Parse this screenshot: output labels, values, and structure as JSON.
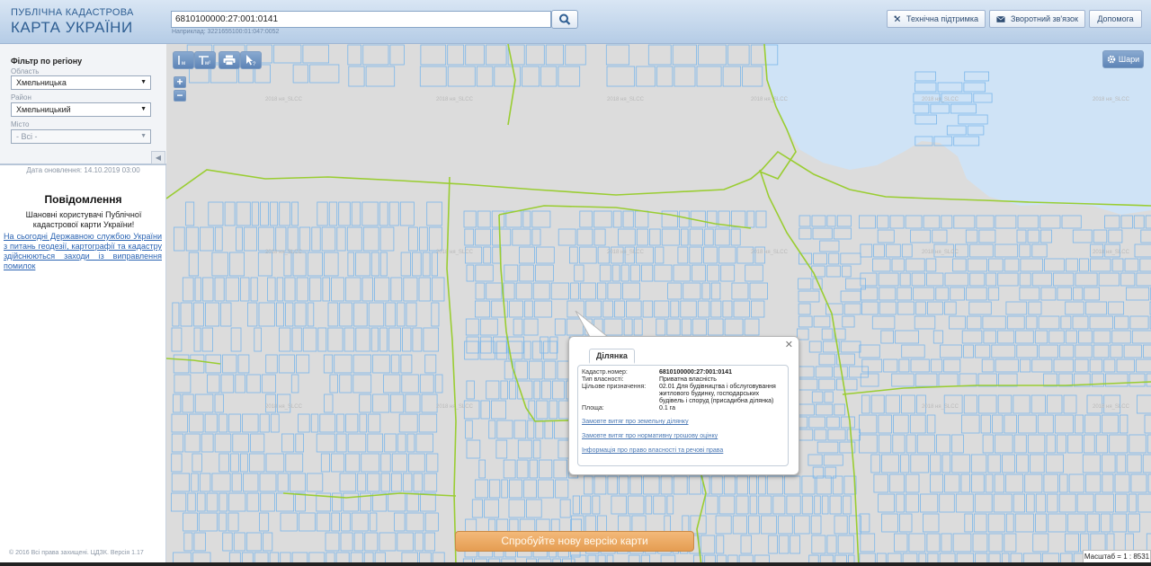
{
  "header": {
    "logo_line1": "ПУБЛІЧНА КАДАСТРОВА",
    "logo_line2": "КАРТА УКРАЇНИ",
    "search_value": "6810100000:27:001:0141",
    "search_hint": "Наприклад: 3221655100:01:047:0052",
    "support_label": "Технічна підтримка",
    "feedback_label": "Зворотний зв'язок",
    "help_label": "Допомога"
  },
  "sidebar": {
    "filter_title": "Фільтр по регіону",
    "region_label": "Область",
    "region_value": "Хмельницька",
    "district_label": "Район",
    "district_value": "Хмельницький",
    "city_label": "Місто",
    "city_value": "- Всі -",
    "update_date": "Дата оновлення: 14.10.2019 03:00",
    "message_title": "Повідомлення",
    "message_text": "Шановні користувачі Публічної кадастрової карти України!",
    "message_link": "На сьогодні Державною службою України з питань геодезії, картографії та кадастру здійснюються заходи із виправлення помилок",
    "copyright": "© 2016 Всі права захищені. ЦДЗК. Версія 1.17"
  },
  "map": {
    "layers_label": "Шари",
    "watermark": "2018 ня_SLCC",
    "new_version_label": "Спробуйте нову версію карти",
    "scale_label": "Масштаб = 1 : 8531",
    "colors": {
      "parcel": "#7ab6ea",
      "boundary": "#9acd32",
      "water": "#cfe3f6",
      "background": "#dcdcdc"
    }
  },
  "popup": {
    "tab_label": "Ділянка",
    "cadastral_label": "Кадастр.номер:",
    "cadastral_value": "6810100000:27:001:0141",
    "ownership_label": "Тип власності:",
    "ownership_value": "Приватна власність",
    "purpose_label": "Цільове призначення:",
    "purpose_value": "02.01 Для будівництва і обслуговування житлового будинку, господарських будівель і споруд (присадибна ділянка)",
    "area_label": "Площа:",
    "area_value": "0.1 га",
    "link1": "Замовте витяг про земельну ділянку",
    "link2": "Замовте витяг про нормативну грошову оцінку",
    "link3": "Інформація про право власності та речові права"
  }
}
